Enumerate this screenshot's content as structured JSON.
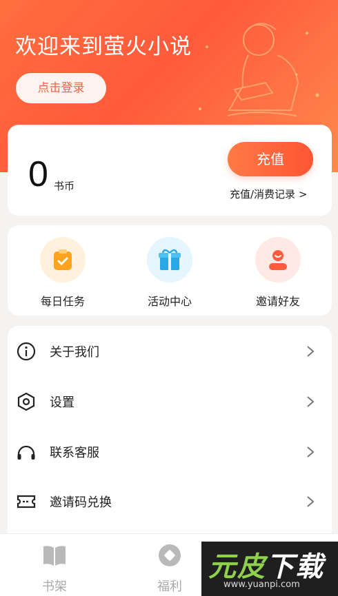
{
  "header": {
    "welcome": "欢迎来到萤火小说",
    "login_label": "点击登录"
  },
  "wallet": {
    "coins": "0",
    "unit": "书币",
    "recharge_label": "充值",
    "records_label": "充值/消费记录 >"
  },
  "quick_actions": [
    {
      "label": "每日任务",
      "icon": "task-clipboard-icon",
      "bg": "#fff1dc",
      "color": "#ffa21e"
    },
    {
      "label": "活动中心",
      "icon": "gift-icon",
      "bg": "#e4f5fd",
      "color": "#2aa7e6"
    },
    {
      "label": "邀请好友",
      "icon": "invite-friend-icon",
      "bg": "#ffe9e4",
      "color": "#ff5a3c"
    }
  ],
  "menu": [
    {
      "label": "关于我们",
      "icon": "info-icon"
    },
    {
      "label": "设置",
      "icon": "settings-hexagon-icon"
    },
    {
      "label": "联系客服",
      "icon": "headset-icon"
    },
    {
      "label": "邀请码兑换",
      "icon": "ticket-icon"
    }
  ],
  "tabs": [
    {
      "label": "书架",
      "icon": "bookshelf-icon"
    },
    {
      "label": "福利",
      "icon": "welfare-icon"
    }
  ],
  "watermark": {
    "brand_green": "元皮",
    "brand_white": "下载",
    "url": "www.yuanpi.com"
  },
  "colors": {
    "accent": "#ff5a3c",
    "accent_light": "#ff7a45"
  }
}
